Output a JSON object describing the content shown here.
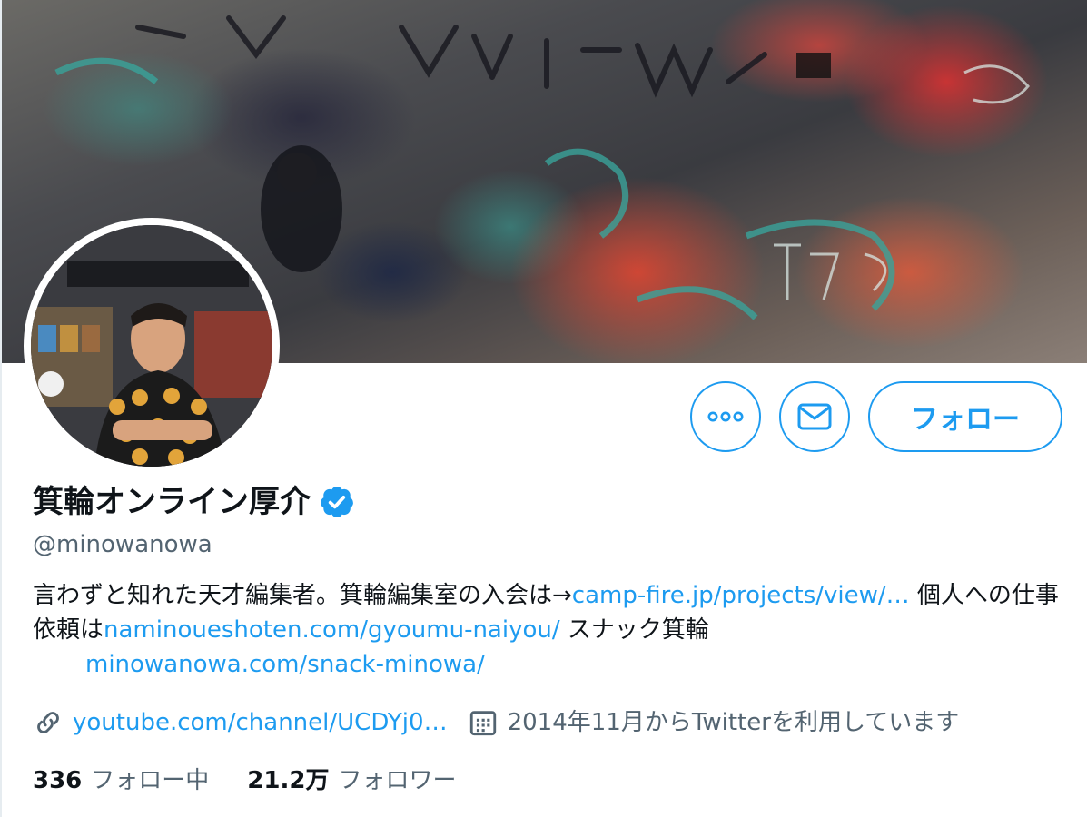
{
  "profile": {
    "display_name": "箕輪オンライン厚介",
    "handle": "@minowanowa",
    "bio": {
      "text_1": "言わずと知れた天才編集者。箕輪編集室の入会は→",
      "link_1": "camp-fire.jp/projects/view/…",
      "text_2": " 個人への仕事依頼は",
      "link_2": "naminoueshoten.com/gyoumu-naiyou/",
      "text_3": " スナック箕輪　",
      "link_3": "minowanowa.com/snack-minowa/"
    },
    "website": "youtube.com/channel/UCDYj0…",
    "joined": "2014年11月からTwitterを利用しています",
    "following_count": "336",
    "following_label": "フォロー中",
    "followers_count": "21.2万",
    "followers_label": "フォロワー"
  },
  "actions": {
    "follow_label": "フォロー",
    "more_icon": "more-icon",
    "message_icon": "mail-icon"
  },
  "colors": {
    "accent": "#1d9bf0",
    "secondary_text": "#536471",
    "primary_text": "#0f1419"
  }
}
